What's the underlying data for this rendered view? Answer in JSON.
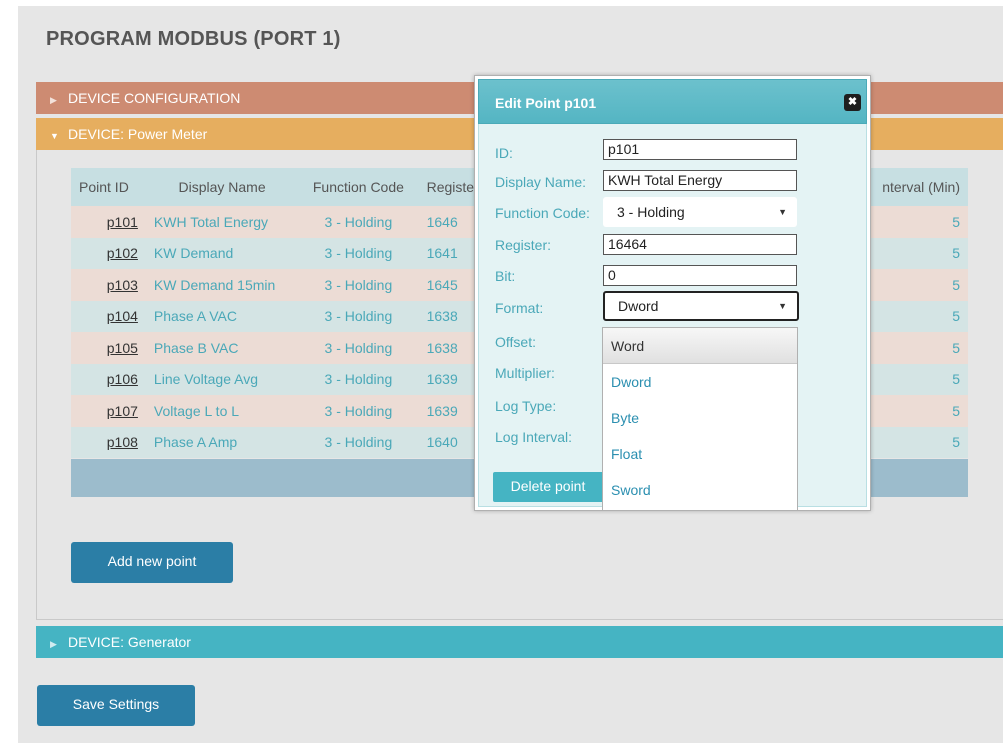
{
  "page": {
    "title": "PROGRAM MODBUS (PORT 1)"
  },
  "accordion": {
    "device_configuration": "DEVICE CONFIGURATION",
    "device_power_meter": "DEVICE: Power Meter",
    "device_generator": "DEVICE: Generator"
  },
  "table": {
    "headers": {
      "point_id": "Point ID",
      "display_name": "Display Name",
      "function_code": "Function Code",
      "register": "Registe",
      "log_interval": "nterval (Min)"
    },
    "rows": [
      {
        "id": "p101",
        "name": "KWH Total Energy",
        "code": "3 - Holding",
        "register": "1646",
        "interval": "5"
      },
      {
        "id": "p102",
        "name": "KW Demand",
        "code": "3 - Holding",
        "register": "1641",
        "interval": "5"
      },
      {
        "id": "p103",
        "name": "KW Demand 15min",
        "code": "3 - Holding",
        "register": "1645",
        "interval": "5"
      },
      {
        "id": "p104",
        "name": "Phase A VAC",
        "code": "3 - Holding",
        "register": "1638",
        "interval": "5"
      },
      {
        "id": "p105",
        "name": "Phase B VAC",
        "code": "3 - Holding",
        "register": "1638",
        "interval": "5"
      },
      {
        "id": "p106",
        "name": "Line Voltage Avg",
        "code": "3 - Holding",
        "register": "1639",
        "interval": "5"
      },
      {
        "id": "p107",
        "name": "Voltage L to L",
        "code": "3 - Holding",
        "register": "1639",
        "interval": "5"
      },
      {
        "id": "p108",
        "name": "Phase A Amp",
        "code": "3 - Holding",
        "register": "1640",
        "interval": "5"
      }
    ],
    "pager_prev": "«"
  },
  "buttons": {
    "add_point": "Add new point",
    "save_settings": "Save Settings"
  },
  "modal": {
    "title": "Edit Point p101",
    "close_glyph": "✖",
    "labels": {
      "id": "ID:",
      "display_name": "Display Name:",
      "function_code": "Function Code:",
      "register": "Register:",
      "bit": "Bit:",
      "format": "Format:",
      "offset": "Offset:",
      "multiplier": "Multiplier:",
      "log_type": "Log Type:",
      "log_interval": "Log Interval:"
    },
    "values": {
      "id": "p101",
      "display_name": "KWH Total Energy",
      "function_code": "3 - Holding",
      "register": "16464",
      "bit": "0",
      "format": "Dword"
    },
    "format_options": [
      "Word",
      "Dword",
      "Byte",
      "Float",
      "Sword"
    ],
    "delete_button": "Delete point"
  },
  "colors": {
    "config_header": "#cd8b72",
    "power_meter_header": "#e6ae5f",
    "generator_header": "#45b4c3",
    "primary_button": "#2b7ea6",
    "accent_teal": "#4aa8b8"
  }
}
